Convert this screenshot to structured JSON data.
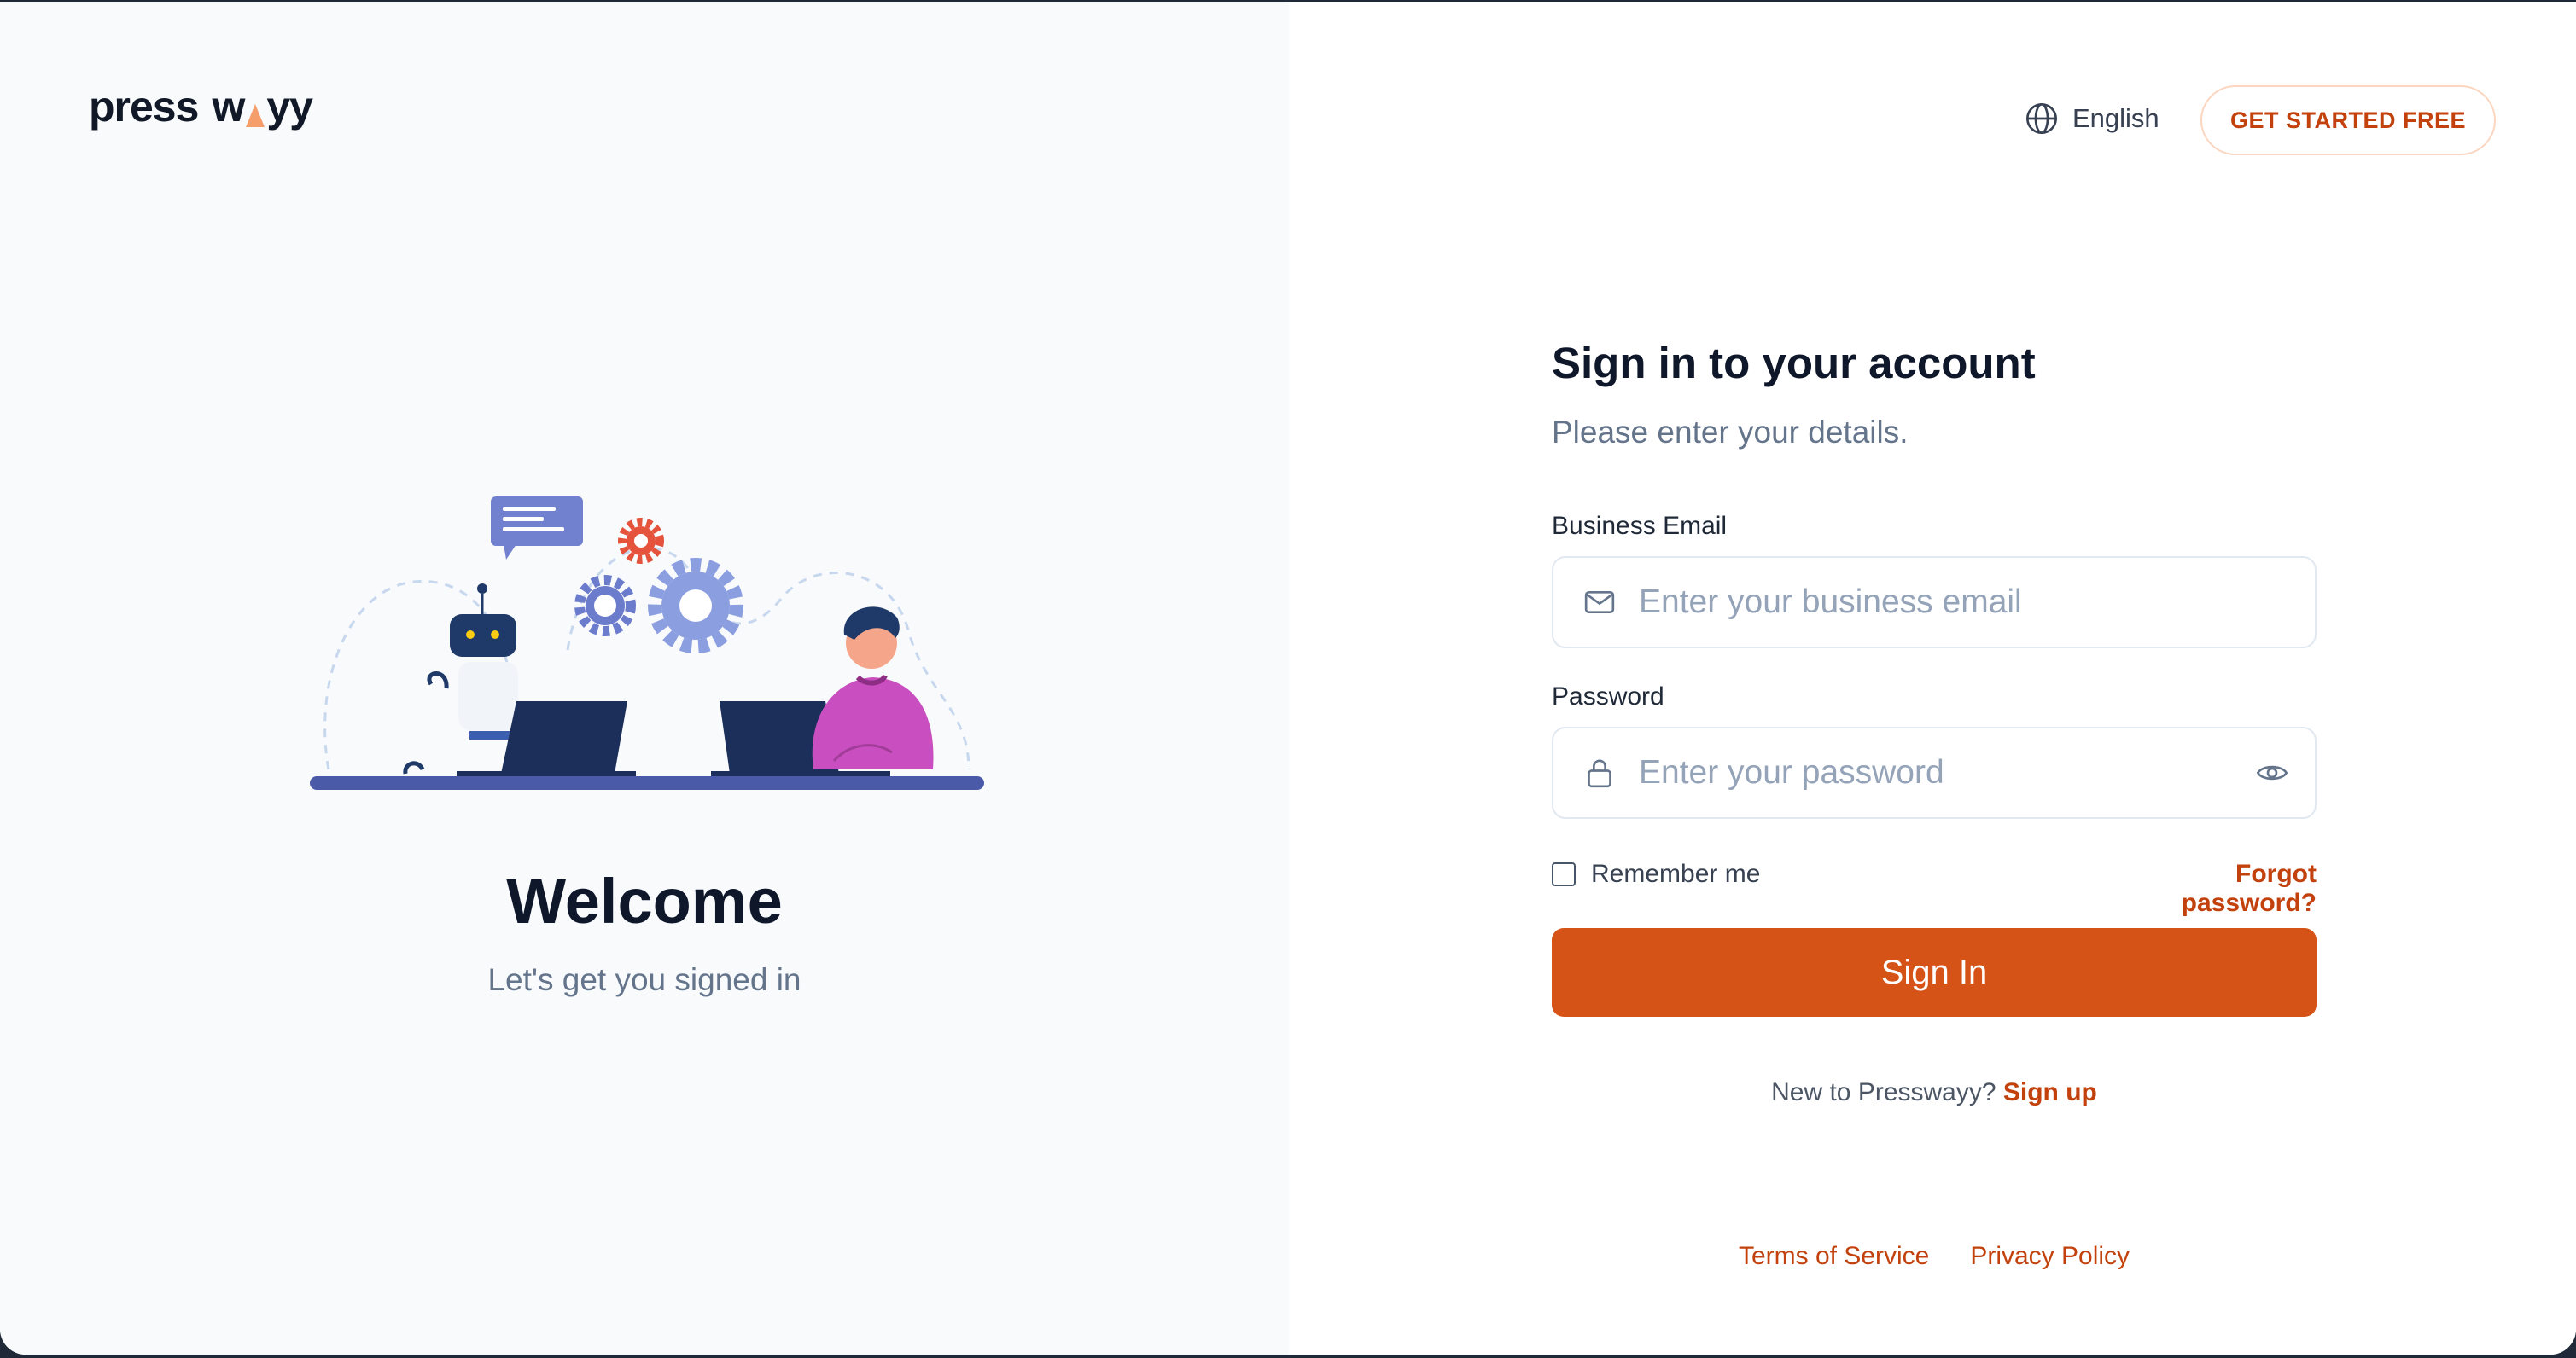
{
  "brand": {
    "logo_left": "press",
    "logo_mid": "w",
    "logo_right": "yy",
    "accent_color": "#d55317",
    "dark_color": "#0f172a"
  },
  "hero": {
    "title": "Welcome",
    "subtitle": "Let's get you signed in",
    "illustration_icon": "robot-and-person-at-laptops-illustration"
  },
  "header": {
    "language_icon": "globe-icon",
    "language_label": "English",
    "cta_label": "GET STARTED FREE"
  },
  "form": {
    "title": "Sign in to your account",
    "subtitle": "Please enter your details.",
    "email": {
      "label": "Business Email",
      "placeholder": "Enter your business email",
      "value": "",
      "icon": "mail-icon"
    },
    "password": {
      "label": "Password",
      "placeholder": "Enter your password",
      "value": "",
      "icon": "lock-icon",
      "toggle_icon": "eye-icon"
    },
    "remember_label": "Remember me",
    "remember_checked": false,
    "forgot_label": "Forgot password?",
    "submit_label": "Sign In",
    "signup_prompt": "New to Presswayy?",
    "signup_link": "Sign up"
  },
  "footer": {
    "terms": "Terms of Service",
    "privacy": "Privacy Policy"
  }
}
